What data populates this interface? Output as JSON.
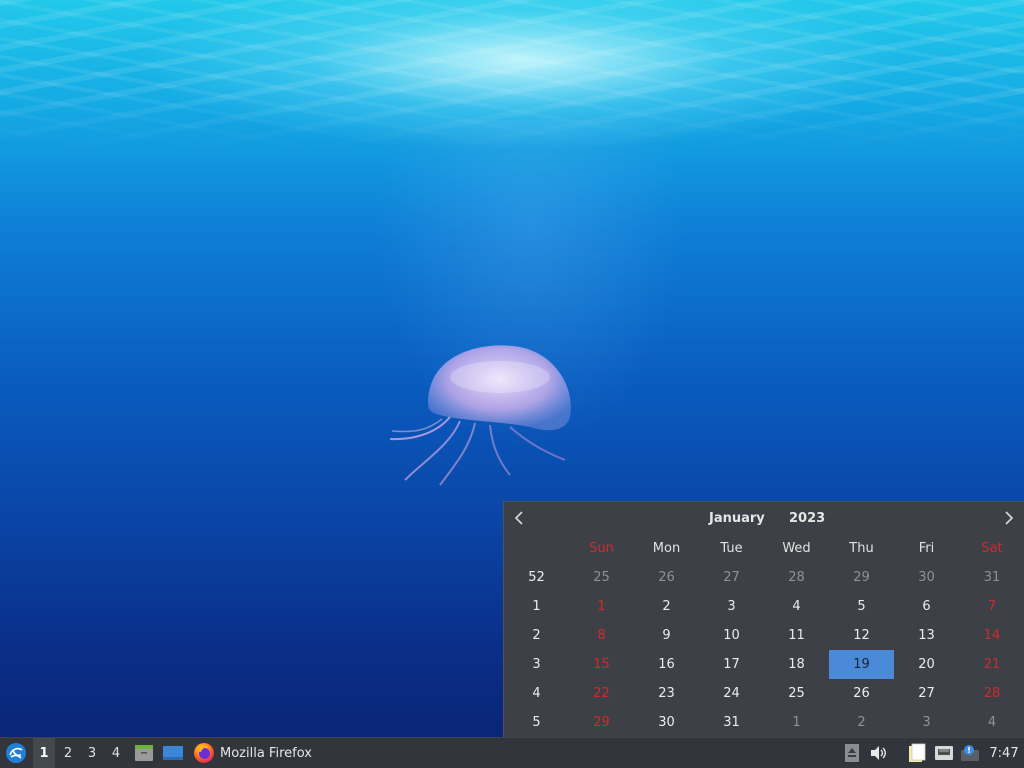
{
  "calendar": {
    "month": "January",
    "year": "2023",
    "day_names": [
      "Sun",
      "Mon",
      "Tue",
      "Wed",
      "Thu",
      "Fri",
      "Sat"
    ],
    "weeks": [
      {
        "num": "52",
        "days": [
          "25",
          "26",
          "27",
          "28",
          "29",
          "30",
          "31"
        ]
      },
      {
        "num": "1",
        "days": [
          "1",
          "2",
          "3",
          "4",
          "5",
          "6",
          "7"
        ]
      },
      {
        "num": "2",
        "days": [
          "8",
          "9",
          "10",
          "11",
          "12",
          "13",
          "14"
        ]
      },
      {
        "num": "3",
        "days": [
          "15",
          "16",
          "17",
          "18",
          "19",
          "20",
          "21"
        ]
      },
      {
        "num": "4",
        "days": [
          "22",
          "23",
          "24",
          "25",
          "26",
          "27",
          "28"
        ]
      },
      {
        "num": "5",
        "days": [
          "29",
          "30",
          "31",
          "1",
          "2",
          "3",
          "4"
        ]
      }
    ],
    "selected_day": "19",
    "colors": {
      "today": "#4a8ad8",
      "weekend": "#d02b2b",
      "background": "#3d4047"
    }
  },
  "taskbar": {
    "workspaces": [
      "1",
      "2",
      "3",
      "4"
    ],
    "active_workspace": "1",
    "app_label": "Mozilla Firefox",
    "clock": "7:47"
  },
  "icons": {
    "start": "lubuntu-logo-icon",
    "file_manager": "file-manager-icon",
    "show_desktop": "show-desktop-icon",
    "firefox": "firefox-icon",
    "eject": "eject-icon",
    "volume": "volume-icon",
    "clipboard": "clipboard-icon",
    "network": "network-icon",
    "updates": "update-notifier-icon"
  }
}
